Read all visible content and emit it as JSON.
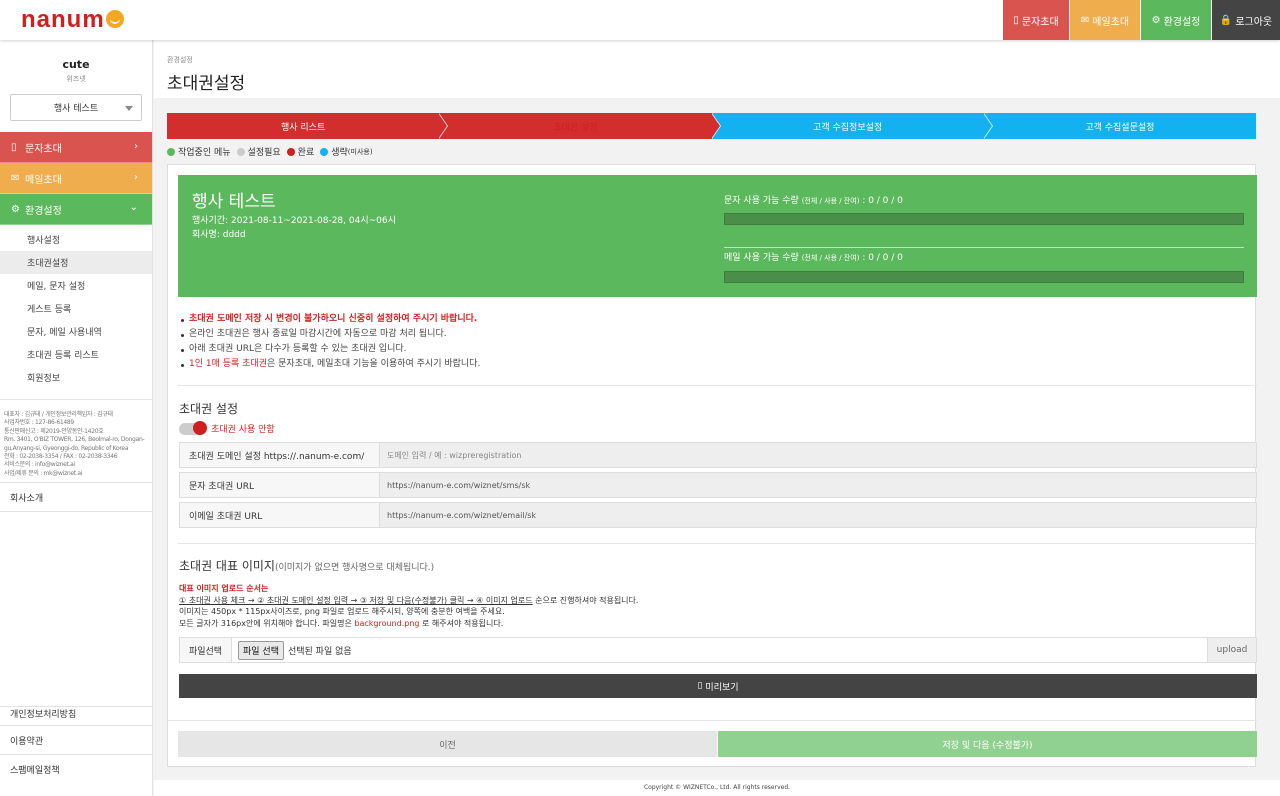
{
  "topbar": {
    "logo": "nanum",
    "buttons": [
      {
        "label": "문자초대",
        "color": "#d9534f",
        "icon": "mobile-icon"
      },
      {
        "label": "메일초대",
        "color": "#f0ad4e",
        "icon": "mail-icon"
      },
      {
        "label": "환경설정",
        "color": "#5cb85c",
        "icon": "gear-icon"
      },
      {
        "label": "로그아웃",
        "color": "#444444",
        "icon": "lock-icon"
      }
    ]
  },
  "sidebar": {
    "user_name": "cute",
    "user_org": "위즈넷",
    "event_select": "행사 테스트",
    "menus": [
      {
        "label": "문자초대",
        "color": "#d9534f"
      },
      {
        "label": "메일초대",
        "color": "#f0ad4e"
      },
      {
        "label": "환경설정",
        "color": "#5cb85c"
      }
    ],
    "submenu": [
      "행사설정",
      "초대권설정",
      "메일, 문자 설정",
      "게스트 등록",
      "문자, 메일 사용내역",
      "초대권 등록 리스트",
      "회원정보"
    ],
    "active_submenu": "초대권설정",
    "company": [
      "대표자 : 김규태 / 개인정보관리책임자 : 김규태",
      "사업자번호 : 127-86-61489",
      "통신판매신고 : 제2019-안양동안-1420호",
      "Rm. 3401, O'BIZ TOWER, 126, Beolmal-ro, Dongan-gu,Anyang-si, Gyeonggi-do, Republic of Korea",
      "전화 : 02-2038-3354 / FAX : 02-2038-3346",
      "서비스문의 : info@wiznet.ai",
      "사업/제휴 문의 : mk@wiznet.ai"
    ],
    "links": [
      "회사소개",
      "개인정보처리방침",
      "이용약관",
      "스팸메일정책"
    ]
  },
  "page": {
    "breadcrumb": "환경설정",
    "title": "초대권설정"
  },
  "steps": [
    {
      "label": "행사 리스트",
      "color": "#d32e2e"
    },
    {
      "label": "초대권 설정",
      "color": "#d32e2e"
    },
    {
      "label": "고객 수집정보설정",
      "color": "#13b1f0"
    },
    {
      "label": "고객 수집설문설정",
      "color": "#13b1f0"
    }
  ],
  "legend": [
    {
      "label": "작업중인 메뉴",
      "color": "#5cb85c"
    },
    {
      "label": "설정필요",
      "color": "#cccccc"
    },
    {
      "label": "완료",
      "color": "#d11f1f"
    },
    {
      "label": "생략",
      "sub": "(미사용)",
      "color": "#13b1f0"
    }
  ],
  "event": {
    "title": "행사 테스트",
    "period": "행사기간: 2021-08-11~2021-08-28, 04시~06시",
    "company": "회사명: dddd",
    "sms_usage_label": "문자 사용 가능 수량",
    "sms_usage_sub": "(전체 / 사용 / 잔여)",
    "sms_usage_value": ": 0 / 0 / 0",
    "sms_usage_ratio": 0,
    "mail_usage_label": "메일 사용 가능 수량",
    "mail_usage_sub": "(전체 / 사용 / 잔여)",
    "mail_usage_value": ": 0 / 0 / 0",
    "mail_usage_ratio": 0
  },
  "notes": {
    "n1": "초대권 도메인 저장 시 변경이 불가하오니 신중히 설정하여 주시기 바랍니다.",
    "n2": "온라인 초대권은 행사 종료일 마감시간에 자동으로 마감 처리 됩니다.",
    "n3": "아래 초대권 URL은 다수가 등록할 수 있는 초대권 입니다.",
    "n4_red": "1인 1매 등록 초대권",
    "n4_rest": "은 문자초대, 메일초대 기능을 이용하여 주시기 바랍니다."
  },
  "invite": {
    "section_title": "초대권 설정",
    "toggle_label": "초대권 사용 안함",
    "rows": [
      {
        "label": "초대권 도메인 설정 https://.nanum-e.com/",
        "value": "도메인 입력 / 예 : wizpreregistration"
      },
      {
        "label": "문자 초대권 URL",
        "value": "https://nanum-e.com/wiznet/sms/sk"
      },
      {
        "label": "이메일 초대권 URL",
        "value": "https://nanum-e.com/wiznet/email/sk"
      }
    ]
  },
  "image": {
    "section_title": "초대권 대표 이미지",
    "section_sub": "(이미지가 없으면 행사명으로 대체됩니다.)",
    "order_title": "대표 이미지 업로드 순서는",
    "order_u": "① 초대권 사용 체크 → ② 초대권 도메인 설정 입력 → ③ 저장 및 다음(수정불가) 클릭 → ④ 이미지 업로드",
    "order_rest": " 순으로 진행하셔야 적용됩니다.",
    "line2": "이미지는 450px * 115px사이즈로, png 파일로 업로드 해주시되, 양쪽에 충분한 여백을 주세요.",
    "line3_a": "모든 글자가 316px안에 위치해야 합니다. 파일명은 ",
    "line3_red": "background.png",
    "line3_b": " 로 해주셔야 적용됩니다.",
    "file_label": "파일선택",
    "file_button": "파일 선택",
    "file_status": "선택된 파일 없음",
    "upload": "upload",
    "preview": "미리보기"
  },
  "actions": {
    "prev": "이전",
    "next": "저장 및 다음 (수정불가)"
  },
  "footer": "Copyright © WIZNETCo., Ltd. All rights reserved."
}
